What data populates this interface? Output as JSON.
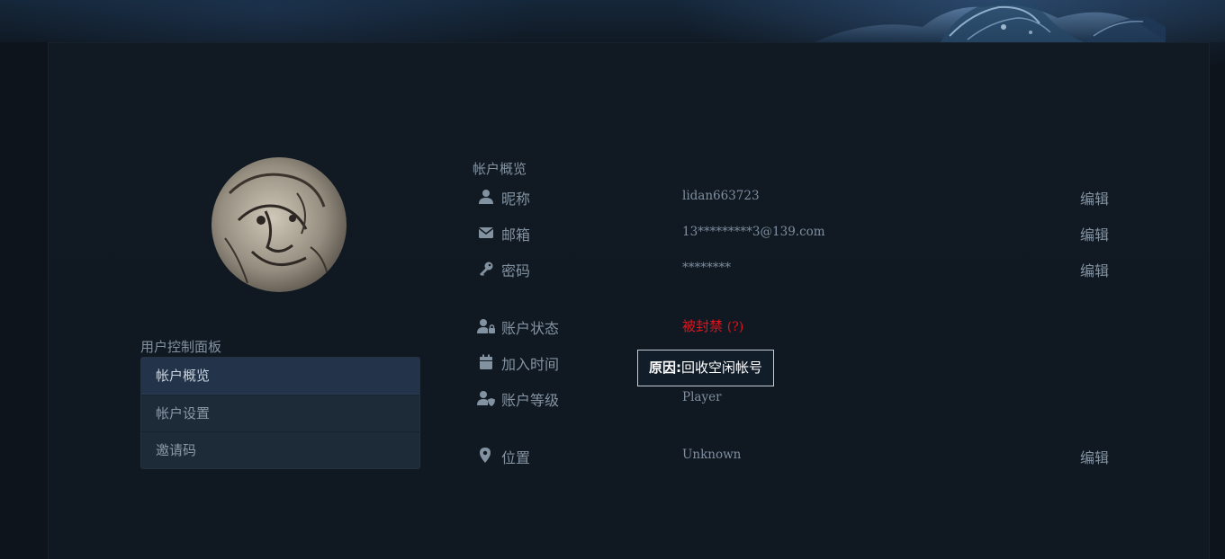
{
  "sidebar": {
    "title": "用户控制面板",
    "items": [
      {
        "label": "帐户概览",
        "active": true
      },
      {
        "label": "帐户设置",
        "active": false
      },
      {
        "label": "邀请码",
        "active": false
      }
    ]
  },
  "overview": {
    "title": "帐户概览",
    "nickname": {
      "label": "昵称",
      "value": "lidan663723",
      "edit": "编辑",
      "icon": "user-icon"
    },
    "email": {
      "label": "邮箱",
      "value": "13*********3@139.com",
      "edit": "编辑",
      "icon": "envelope-icon"
    },
    "password": {
      "label": "密码",
      "value": "********",
      "edit": "编辑",
      "icon": "key-icon"
    },
    "status": {
      "label": "账户状态",
      "value": "被封禁",
      "help": "(?)",
      "icon": "user-lock-icon"
    },
    "joined": {
      "label": "加入时间",
      "icon": "calendar-icon"
    },
    "level": {
      "label": "账户等级",
      "value": "Player",
      "icon": "user-shield-icon"
    },
    "location": {
      "label": "位置",
      "value": "Unknown",
      "edit": "编辑",
      "icon": "map-pin-icon"
    }
  },
  "tooltip": {
    "key": "原因:",
    "text": "回收空闲帐号"
  },
  "colors": {
    "background": "#0d141c",
    "panel": "#111a23",
    "text_muted": "#8392a1",
    "banned": "#e0141e",
    "menu_active": "#23344a"
  }
}
